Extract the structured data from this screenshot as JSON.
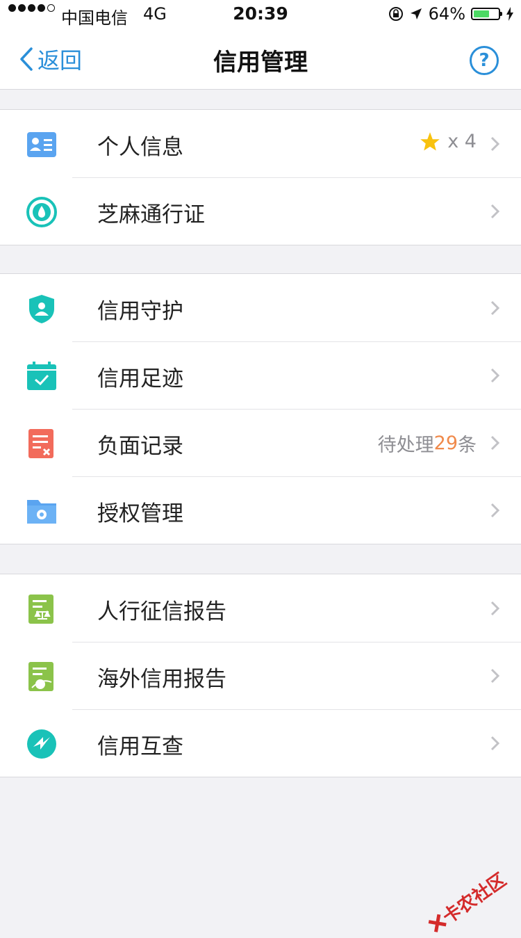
{
  "status": {
    "carrier": "中国电信",
    "network": "4G",
    "time": "20:39",
    "battery": "64%",
    "battery_level": 0.64
  },
  "nav": {
    "back_label": "返回",
    "title": "信用管理",
    "help_label": "?"
  },
  "groups": [
    {
      "items": [
        {
          "label": "个人信息",
          "icon": "id-card-icon",
          "extra_text": "x 4",
          "extra_icon": "star-icon"
        },
        {
          "label": "芝麻通行证",
          "icon": "sesame-pass-icon"
        }
      ]
    },
    {
      "items": [
        {
          "label": "信用守护",
          "icon": "shield-user-icon"
        },
        {
          "label": "信用足迹",
          "icon": "calendar-check-icon"
        },
        {
          "label": "负面记录",
          "icon": "negative-record-icon",
          "extra_prefix": "待处理",
          "extra_num": "29",
          "extra_suffix": "条"
        },
        {
          "label": "授权管理",
          "icon": "folder-gear-icon"
        }
      ]
    },
    {
      "items": [
        {
          "label": "人行征信报告",
          "icon": "bank-report-icon"
        },
        {
          "label": "海外信用报告",
          "icon": "overseas-report-icon"
        },
        {
          "label": "信用互查",
          "icon": "mutual-check-icon"
        }
      ]
    }
  ],
  "watermark": "卡农社区",
  "colors": {
    "accent": "#2a8fd9",
    "teal": "#19c2b8",
    "red": "#f26b5b",
    "green": "#8bc34a",
    "blue_icon": "#5aa4f0",
    "orange_count": "#f08a4b"
  }
}
